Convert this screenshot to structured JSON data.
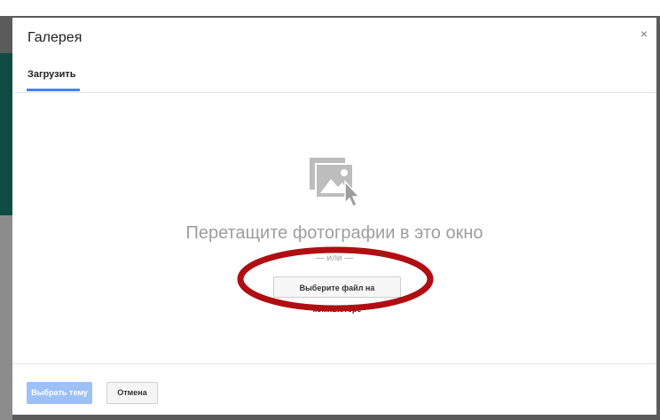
{
  "dialog": {
    "title": "Галерея",
    "close_symbol": "×",
    "tabs": [
      {
        "label": "Загрузить",
        "active": true
      }
    ]
  },
  "dropzone": {
    "icon": "image-upload-icon",
    "drop_text": "Перетащите фотографии в это окно",
    "or_text": "— или —",
    "choose_file_label": "Выберите файл на компьютере"
  },
  "footer": {
    "select_theme_label": "Выбрать тему",
    "cancel_label": "Отмена"
  },
  "colors": {
    "accent": "#4285f4",
    "primary_disabled": "#9dc0f7",
    "annotation_red": "#b00e12",
    "backdrop": "#5b5b5b"
  }
}
